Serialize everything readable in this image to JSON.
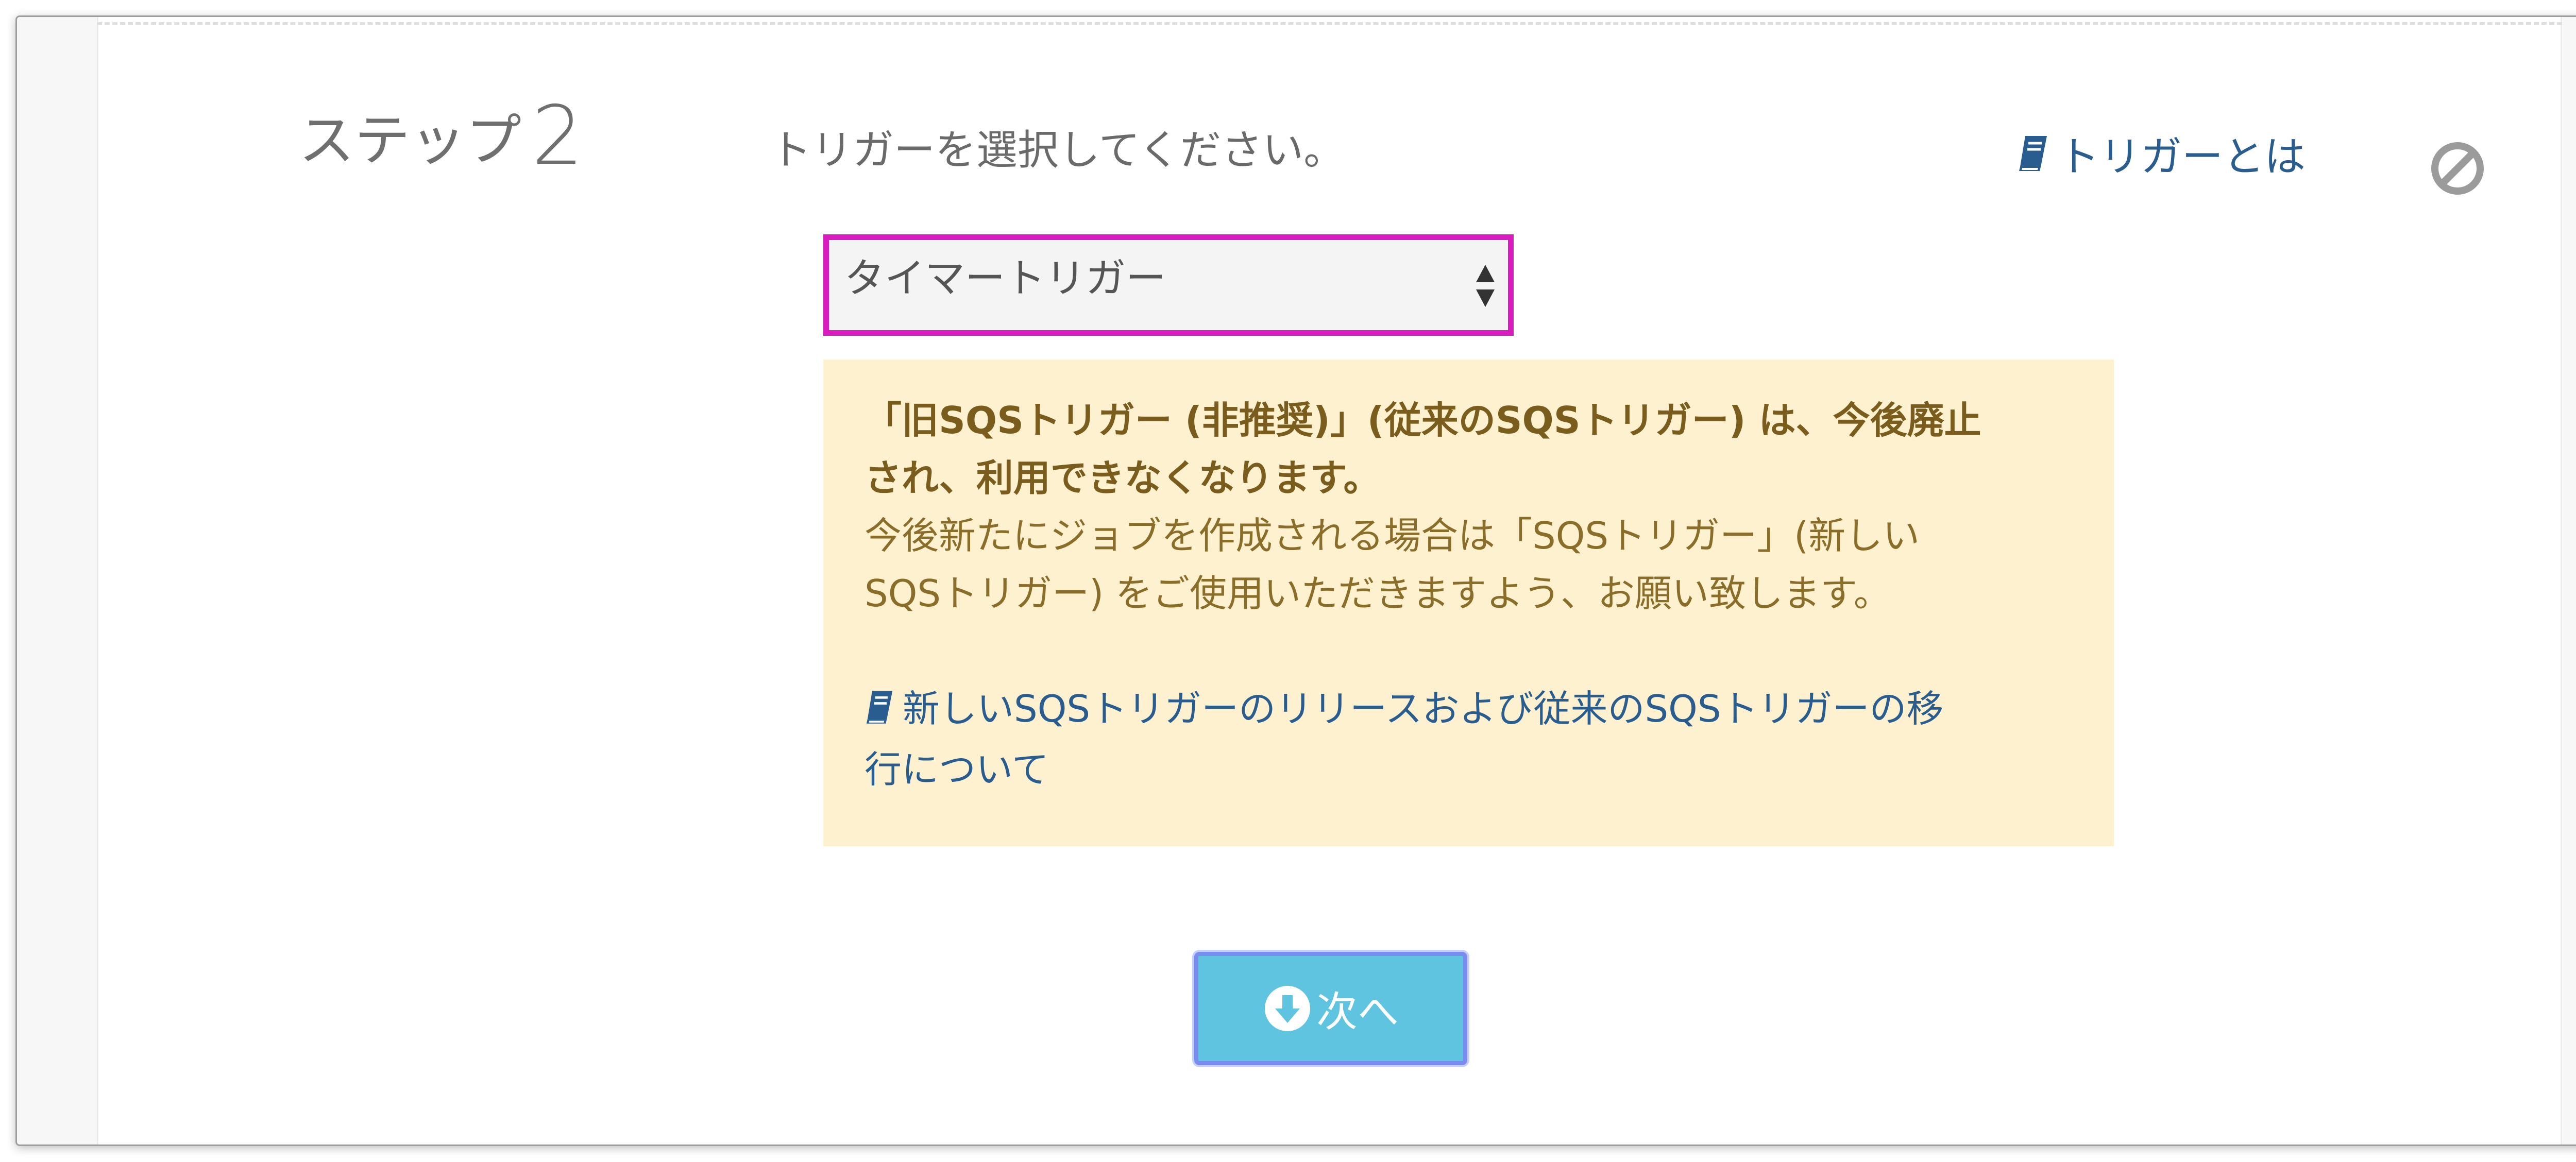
{
  "step": {
    "label": "ステップ",
    "number": "2"
  },
  "instruction": "トリガーを選択してください。",
  "help_link": {
    "label": "トリガーとは",
    "icon": "book-icon"
  },
  "clear_icon": "ban-icon",
  "trigger_select": {
    "selected": "タイマートリガー",
    "icon": "sort-arrows-icon"
  },
  "notice": {
    "bold_line1": "「旧SQSトリガー (非推奨)」(従来のSQSトリガー) は、今後廃止",
    "bold_line2": "され、利用できなくなります。",
    "body_line1": "今後新たにジョブを作成される場合は「SQSトリガー」(新しい",
    "body_line2": "SQSトリガー) をご使用いただきますよう、お願い致します。",
    "link_line1": "新しいSQSトリガーのリリースおよび従来のSQSトリガーの移",
    "link_line2": "行について"
  },
  "next_button": {
    "label": "次へ",
    "icon": "arrow-circle-down-icon"
  },
  "colors": {
    "highlight_border": "#d91bbf",
    "notice_bg": "#fdf1cf",
    "link": "#2a5d8f",
    "button_bg": "#5ec4df"
  }
}
